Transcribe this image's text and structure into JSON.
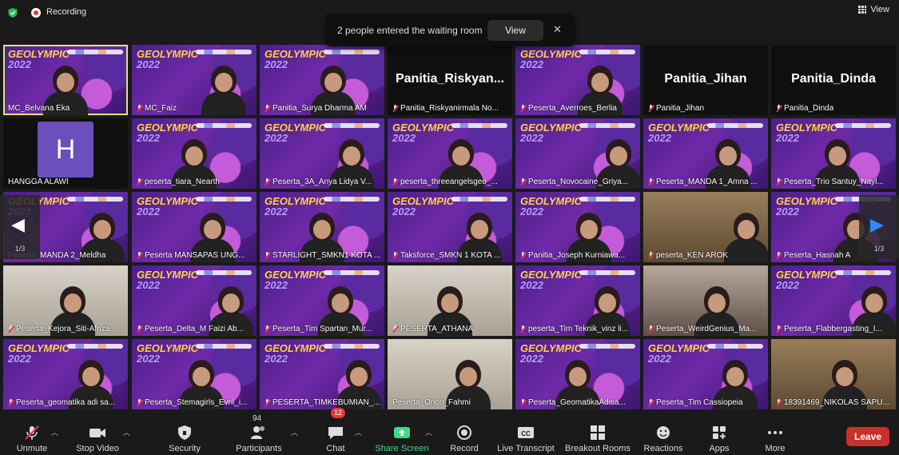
{
  "topbar": {
    "recording_label": "Recording",
    "view_label": "View"
  },
  "toast": {
    "message": "2 people entered the waiting room",
    "view_label": "View",
    "close": "✕"
  },
  "pager": {
    "left_page": "1/3",
    "right_page": "1/3"
  },
  "grid": {
    "rows": [
      [
        {
          "label": "MC_Belvana Eka",
          "bg": "purple",
          "muted": false,
          "active": true
        },
        {
          "label": "MC_Faiz",
          "bg": "purple",
          "muted": true
        },
        {
          "label": "Panitia_Surya Dharma AM",
          "bg": "purple",
          "muted": true
        },
        {
          "label": "Panitia_Riskyanirmala No...",
          "bg": "name",
          "big": "Panitia_Riskyan...",
          "muted": true
        },
        {
          "label": "Peserta_Averroes_Berlia",
          "bg": "purple",
          "muted": true
        },
        {
          "label": "Panitia_Jihan",
          "bg": "name",
          "big": "Panitia_Jihan",
          "muted": true
        },
        {
          "label": "Panitia_Dinda",
          "bg": "name",
          "big": "Panitia_Dinda",
          "muted": true
        }
      ],
      [
        {
          "label": "HANGGA ALAWI",
          "bg": "avatar",
          "initial": "H",
          "muted": false
        },
        {
          "label": "peserta_tiara_Nearth",
          "bg": "purple",
          "muted": true
        },
        {
          "label": "Peserta_3A_Anya Lidya V...",
          "bg": "purple",
          "muted": true
        },
        {
          "label": "peserta_threeangelsgeo_...",
          "bg": "purple",
          "muted": true
        },
        {
          "label": "Peserta_Novocaine_Griya...",
          "bg": "purple",
          "muted": true
        },
        {
          "label": "Peserta_MANDA 1_Amna ...",
          "bg": "purple",
          "muted": true
        },
        {
          "label": "Peserta_Trio Santuy_Nayl...",
          "bg": "purple",
          "muted": true
        }
      ],
      [
        {
          "label": "Peserta_MANDA 2_Meldha",
          "bg": "purple",
          "muted": false
        },
        {
          "label": "Peserta MANSAPAS UNG...",
          "bg": "purple",
          "muted": true
        },
        {
          "label": "STARLIGHT_SMKN1 KOTA ...",
          "bg": "purple",
          "muted": true
        },
        {
          "label": "Taksforce_SMKN 1 KOTA ...",
          "bg": "purple",
          "muted": true
        },
        {
          "label": "Panitia_Joseph Kurniawa...",
          "bg": "purple",
          "muted": true
        },
        {
          "label": "peserta_KEN AROK",
          "bg": "room",
          "muted": true
        },
        {
          "label": "Peserta_Hasnah A",
          "bg": "purple",
          "muted": true
        }
      ],
      [
        {
          "label": "Peserta_Kejora_Siti-Afriza...",
          "bg": "light",
          "muted": true
        },
        {
          "label": "Peserta_Delta_M Faizi Ab...",
          "bg": "purple",
          "muted": true
        },
        {
          "label": "Peserta_Tim Spartan_Mur...",
          "bg": "purple",
          "muted": true
        },
        {
          "label": "PESERTA_ATHANA",
          "bg": "light",
          "muted": true
        },
        {
          "label": "peserta_Tim Teknik_vinz li...",
          "bg": "purple",
          "muted": true
        },
        {
          "label": "Peserta_WeirdGenius_Ma...",
          "bg": "home",
          "muted": true
        },
        {
          "label": "Peserta_Flabbergasting_I...",
          "bg": "purple",
          "muted": true
        }
      ],
      [
        {
          "label": "Peserta_geomatika adi sa...",
          "bg": "purple",
          "muted": true
        },
        {
          "label": "Peserta_Stemagirls_Evril_i...",
          "bg": "purple",
          "muted": true
        },
        {
          "label": "PESERTA_TIMKEBUMIAN_...",
          "bg": "purple",
          "muted": true
        },
        {
          "label": "Peserta_Orion_Fahmi",
          "bg": "light",
          "muted": false
        },
        {
          "label": "Peserta_GeomatikaAdisa...",
          "bg": "purple",
          "muted": true
        },
        {
          "label": "Peserta_Tim Cassiopeia",
          "bg": "purple",
          "muted": true
        },
        {
          "label": "18391469_NIKOLAS SAPU...",
          "bg": "room",
          "muted": true
        }
      ]
    ],
    "banner_title": "GEOLYMPIC",
    "banner_year": "2022"
  },
  "toolbar": {
    "unmute": "Unmute",
    "stop_video": "Stop Video",
    "security": "Security",
    "participants": "Participants",
    "participants_count": "94",
    "chat": "Chat",
    "chat_badge": "12",
    "share_screen": "Share Screen",
    "record": "Record",
    "live_transcript": "Live Transcript",
    "breakout_rooms": "Breakout Rooms",
    "reactions": "Reactions",
    "apps": "Apps",
    "more": "More",
    "leave": "Leave"
  },
  "colors": {
    "accent_green": "#3ddc84",
    "leave_red": "#c9302c",
    "active_speaker": "#e3e37a"
  }
}
